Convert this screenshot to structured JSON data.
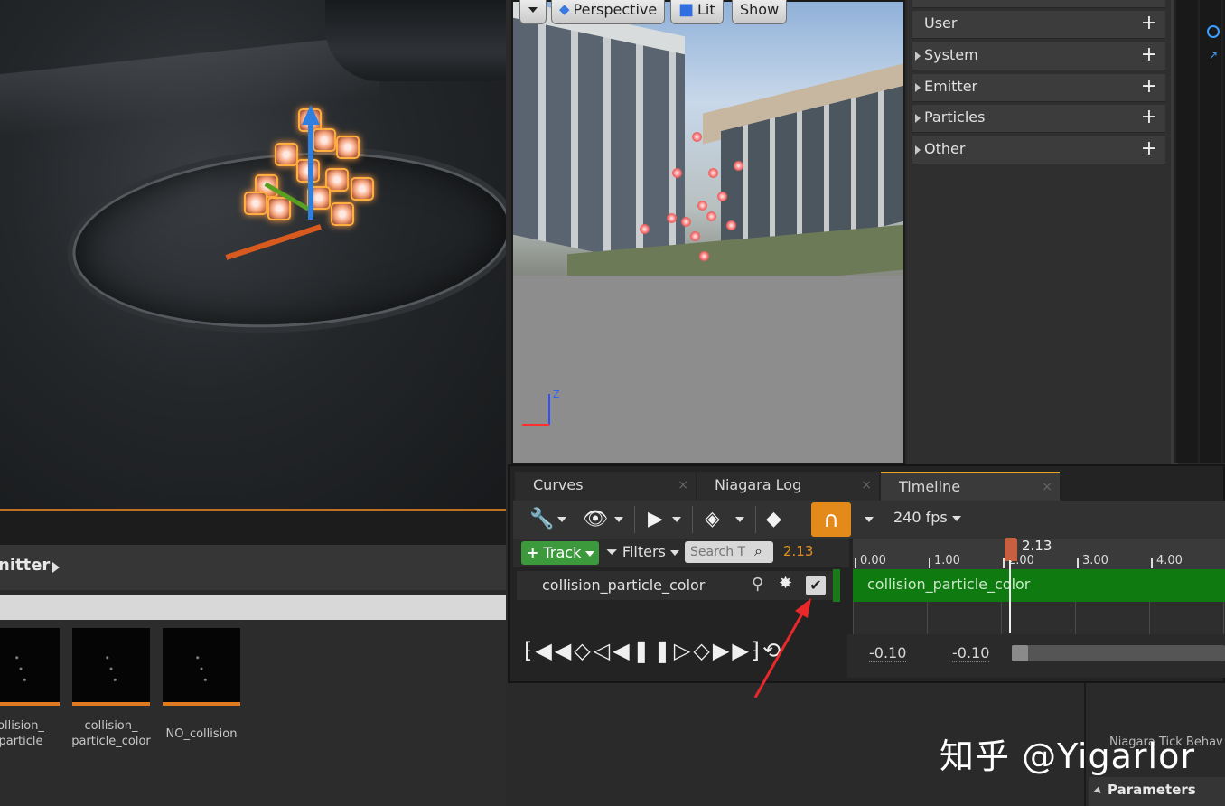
{
  "left_viewport": {
    "header_label": "nitter"
  },
  "assets": [
    {
      "name": "ollision_\nparticle"
    },
    {
      "name": "collision_\nparticle_color"
    },
    {
      "name": "NO_collision"
    }
  ],
  "center_viewport": {
    "buttons": [
      "Perspective",
      "Lit",
      "Show"
    ],
    "axis_label": "Z"
  },
  "parameters": {
    "rows": [
      {
        "label": "User",
        "expandable": false
      },
      {
        "label": "System",
        "expandable": true
      },
      {
        "label": "Emitter",
        "expandable": true
      },
      {
        "label": "Particles",
        "expandable": true
      },
      {
        "label": "Other",
        "expandable": true
      }
    ],
    "add_glyph": "+"
  },
  "tabs": [
    {
      "label": "Curves",
      "active": false
    },
    {
      "label": "Niagara Log",
      "active": false
    },
    {
      "label": "Timeline",
      "active": true
    }
  ],
  "toolbar": {
    "fps": "240 fps",
    "track_label": "Track",
    "filters_label": "Filters",
    "search_placeholder": "Search T",
    "current_time": "2.13"
  },
  "track": {
    "name": "collision_particle_color",
    "enabled": true
  },
  "timeline": {
    "ticks": [
      "0.00",
      "1.00",
      "2.00",
      "3.00",
      "4.00"
    ],
    "playhead_label": "2.13",
    "playhead_time": 2.13,
    "range_start": "-0.10",
    "range_end": "-0.10"
  },
  "right_lower": {
    "tick_label": "Niagara Tick Behav",
    "parameters_header": "Parameters"
  },
  "watermark": {
    "text": "知乎 @Yigarlor"
  },
  "colors": {
    "accent_orange": "#e38a1a",
    "track_green": "#0f7a0f",
    "time_orange": "#e09020"
  }
}
